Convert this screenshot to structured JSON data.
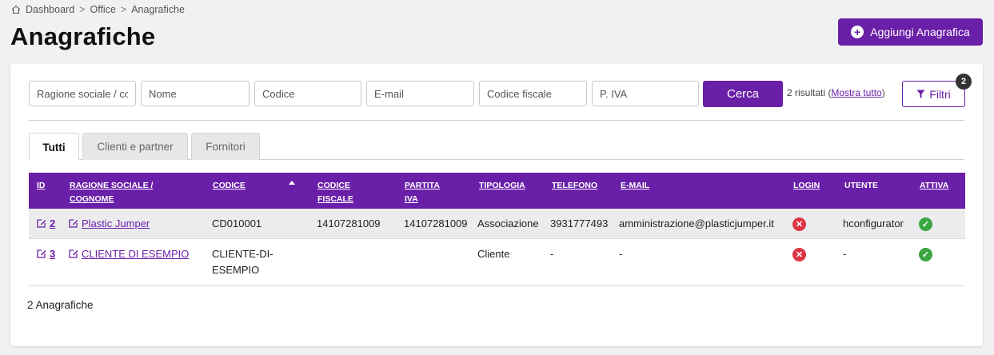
{
  "breadcrumb": {
    "items": [
      "Dashboard",
      "Office",
      "Anagrafiche"
    ],
    "separator": ">"
  },
  "page": {
    "title": "Anagrafiche"
  },
  "actions": {
    "add_label": "Aggiungi Anagrafica"
  },
  "filters": {
    "placeholders": [
      "Ragione sociale / cognome",
      "Nome",
      "Codice",
      "E-mail",
      "Codice fiscale",
      "P. IVA"
    ],
    "search_label": "Cerca",
    "results_prefix": "2 risultati (",
    "show_all_label": "Mostra tutto",
    "results_suffix": ")",
    "filter_label": "Filtri",
    "filter_count": "2"
  },
  "tabs": [
    {
      "label": "Tutti",
      "active": true
    },
    {
      "label": "Clienti e partner",
      "active": false
    },
    {
      "label": "Fornitori",
      "active": false
    }
  ],
  "table": {
    "columns": {
      "id": "ID",
      "ragione_line1": "RAGIONE SOCIALE /",
      "ragione_line2": "COGNOME",
      "codice": "CODICE",
      "cf_line1": "CODICE",
      "cf_line2": "FISCALE",
      "piva_line1": "PARTITA",
      "piva_line2": "IVA",
      "tipologia": "TIPOLOGIA",
      "telefono": "TELEFONO",
      "email": "E-MAIL",
      "login": "LOGIN",
      "utente": "UTENTE",
      "attiva": "ATTIVA"
    },
    "rows": [
      {
        "id": "2",
        "ragione": "Plastic Jumper",
        "codice_line1": "CD010001",
        "codice_line2": "",
        "codice_fiscale": "14107281009",
        "partita_iva": "14107281009",
        "tipologia": "Associazione",
        "telefono": "3931777493",
        "email": "amministrazione@plasticjumper.it",
        "login": false,
        "utente": "hconfigurator",
        "attiva": true
      },
      {
        "id": "3",
        "ragione": "CLIENTE DI ESEMPIO",
        "codice_line1": "CLIENTE-DI-",
        "codice_line2": "ESEMPIO",
        "codice_fiscale": "",
        "partita_iva": "",
        "tipologia": "Cliente",
        "telefono": "-",
        "email": "-",
        "login": false,
        "utente": "-",
        "attiva": true
      }
    ]
  },
  "footer": {
    "count_label": "2 Anagrafiche"
  },
  "colors": {
    "accent": "#6a1fa8",
    "danger": "#dc3545",
    "success": "#3aa640"
  }
}
